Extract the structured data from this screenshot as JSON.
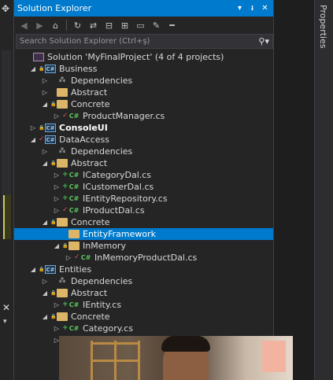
{
  "panel": {
    "title": "Solution Explorer",
    "title_buttons": [
      "▾",
      "ᵻ",
      "✕"
    ],
    "toolbar_icons": [
      "back-icon",
      "forward-icon",
      "home-icon",
      "sync-icon",
      "switch-views-icon",
      "pending-changes-icon",
      "collapse-all-icon",
      "show-all-files-icon",
      "properties-wrench-icon",
      "preview-icon"
    ],
    "search_placeholder": "Search Solution Explorer (Ctrl+ş)"
  },
  "tree": [
    {
      "label": "Solution 'MyFinalProject' (4 of 4 projects)",
      "level": 0,
      "icon": "sln",
      "arrow": "",
      "lock": "",
      "check": ""
    },
    {
      "label": "Business",
      "level": 1,
      "icon": "proj",
      "arrow": "◢",
      "lock": "🔒",
      "check": ""
    },
    {
      "label": "Dependencies",
      "level": 2,
      "icon": "deps",
      "arrow": "▷",
      "lock": "",
      "check": ""
    },
    {
      "label": "Abstract",
      "level": 2,
      "icon": "folder",
      "arrow": "▷",
      "lock": "",
      "check": ""
    },
    {
      "label": "Concrete",
      "level": 2,
      "icon": "folder",
      "arrow": "◢",
      "lock": "🔒",
      "check": ""
    },
    {
      "label": "ProductManager.cs",
      "level": 3,
      "icon": "cs",
      "arrow": "▷",
      "lock": "",
      "check": "✓"
    },
    {
      "label": "ConsoleUI",
      "level": 1,
      "icon": "proj",
      "arrow": "▷",
      "lock": "🔒",
      "check": "",
      "bold": true
    },
    {
      "label": "DataAccess",
      "level": 1,
      "icon": "proj",
      "arrow": "◢",
      "lock": "",
      "check": "✓"
    },
    {
      "label": "Dependencies",
      "level": 2,
      "icon": "deps",
      "arrow": "▷",
      "lock": "",
      "check": ""
    },
    {
      "label": "Abstract",
      "level": 2,
      "icon": "folder",
      "arrow": "◢",
      "lock": "🔒",
      "check": ""
    },
    {
      "label": "ICategoryDal.cs",
      "level": 3,
      "icon": "cs",
      "arrow": "▷",
      "lock": "",
      "check": "+"
    },
    {
      "label": "ICustomerDal.cs",
      "level": 3,
      "icon": "cs",
      "arrow": "▷",
      "lock": "",
      "check": "+"
    },
    {
      "label": "IEntityRepository.cs",
      "level": 3,
      "icon": "cs",
      "arrow": "▷",
      "lock": "",
      "check": "+"
    },
    {
      "label": "IProductDal.cs",
      "level": 3,
      "icon": "cs",
      "arrow": "▷",
      "lock": "",
      "check": "✓"
    },
    {
      "label": "Concrete",
      "level": 2,
      "icon": "folder",
      "arrow": "◢",
      "lock": "🔒",
      "check": ""
    },
    {
      "label": "EntityFramework",
      "level": 3,
      "icon": "folder",
      "arrow": "",
      "lock": "",
      "check": "",
      "selected": true
    },
    {
      "label": "InMemory",
      "level": 3,
      "icon": "folder",
      "arrow": "◢",
      "lock": "🔒",
      "check": ""
    },
    {
      "label": "InMemoryProductDal.cs",
      "level": 4,
      "icon": "cs",
      "arrow": "▷",
      "lock": "",
      "check": "✓"
    },
    {
      "label": "Entities",
      "level": 1,
      "icon": "proj",
      "arrow": "◢",
      "lock": "🔒",
      "check": ""
    },
    {
      "label": "Dependencies",
      "level": 2,
      "icon": "deps",
      "arrow": "▷",
      "lock": "",
      "check": ""
    },
    {
      "label": "Abstract",
      "level": 2,
      "icon": "folder",
      "arrow": "◢",
      "lock": "🔒",
      "check": ""
    },
    {
      "label": "IEntity.cs",
      "level": 3,
      "icon": "cs",
      "arrow": "▷",
      "lock": "",
      "check": "+"
    },
    {
      "label": "Concrete",
      "level": 2,
      "icon": "folder",
      "arrow": "◢",
      "lock": "🔒",
      "check": ""
    },
    {
      "label": "Category.cs",
      "level": 3,
      "icon": "cs",
      "arrow": "▷",
      "lock": "",
      "check": "+"
    },
    {
      "label": "",
      "level": 3,
      "icon": "cs",
      "arrow": "▷",
      "lock": "",
      "check": "+"
    },
    {
      "label": "",
      "level": 3,
      "icon": "cs",
      "arrow": "",
      "lock": "🔒",
      "check": ""
    }
  ],
  "right_panel": {
    "tab_label": "Properties"
  },
  "colors": {
    "accent": "#007acc",
    "background": "#252526",
    "folder": "#dcb567"
  }
}
